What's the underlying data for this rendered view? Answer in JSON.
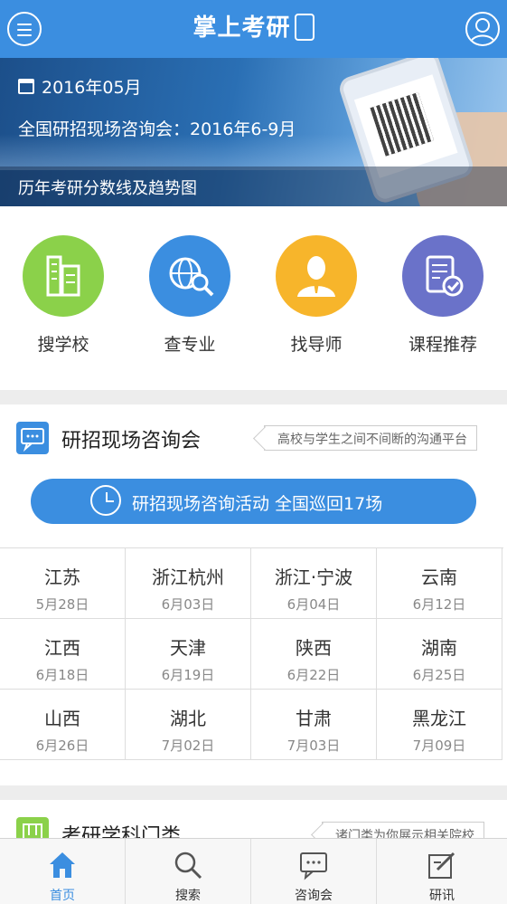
{
  "header": {
    "title": "掌上考研",
    "menu_icon": "menu-icon",
    "user_icon": "user-icon"
  },
  "banner": {
    "date": "2016年05月",
    "line": "全国研招现场咨询会：2016年6-9月",
    "footer": "历年考研分数线及趋势图"
  },
  "categories": [
    {
      "label": "搜学校",
      "icon": "building-icon",
      "color": "#8bd14a"
    },
    {
      "label": "查专业",
      "icon": "globe-search-icon",
      "color": "#3b8ee0"
    },
    {
      "label": "找导师",
      "icon": "teacher-icon",
      "color": "#f7b52b"
    },
    {
      "label": "课程推荐",
      "icon": "course-check-icon",
      "color": "#6a72c9"
    }
  ],
  "consult_section": {
    "title": "研招现场咨询会",
    "note": "高校与学生之间不间断的沟通平台",
    "pill": "研招现场咨询活动 全国巡回17场",
    "events": [
      {
        "prov": "江苏",
        "date": "5月28日"
      },
      {
        "prov": "浙江杭州",
        "date": "6月03日"
      },
      {
        "prov": "浙江·宁波",
        "date": "6月04日"
      },
      {
        "prov": "云南",
        "date": "6月12日"
      },
      {
        "prov": "江西",
        "date": "6月18日"
      },
      {
        "prov": "天津",
        "date": "6月19日"
      },
      {
        "prov": "陕西",
        "date": "6月22日"
      },
      {
        "prov": "湖南",
        "date": "6月25日"
      },
      {
        "prov": "山西",
        "date": "6月26日"
      },
      {
        "prov": "湖北",
        "date": "7月02日"
      },
      {
        "prov": "甘肃",
        "date": "7月03日"
      },
      {
        "prov": "黑龙江",
        "date": "7月09日"
      }
    ]
  },
  "subject_section": {
    "title": "考研学科门类",
    "note": "诸门类为你展示相关院校"
  },
  "tabs": [
    {
      "label": "首页",
      "icon": "home-icon",
      "active": true
    },
    {
      "label": "搜索",
      "icon": "search-icon",
      "active": false
    },
    {
      "label": "咨询会",
      "icon": "chat-icon",
      "active": false
    },
    {
      "label": "研讯",
      "icon": "edit-icon",
      "active": false
    }
  ],
  "colors": {
    "accent": "#3b8ee0",
    "green": "#8bd14a",
    "orange": "#f7b52b",
    "purple": "#6a72c9"
  }
}
